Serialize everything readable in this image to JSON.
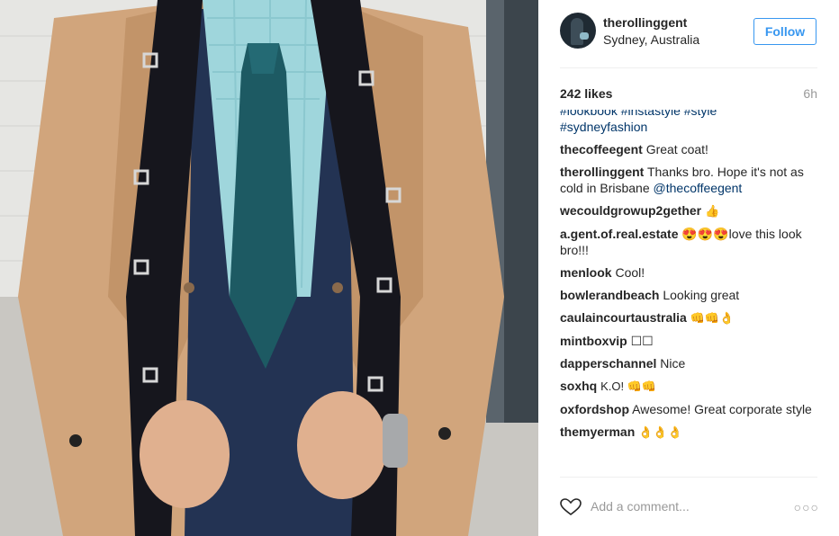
{
  "post": {
    "username": "therollinggent",
    "location": "Sydney, Australia",
    "follow_label": "Follow",
    "likes": "242 likes",
    "time_ago": "6h",
    "caption_cut": "#lookbook #instastyle #style",
    "caption_last": "#sydneyfashion"
  },
  "comments": [
    {
      "user": "thecoffeegent",
      "text": "Great coat!"
    },
    {
      "user": "therollinggent",
      "text": "Thanks bro. Hope it's not as cold in Brisbane ",
      "mention": "@thecoffeegent"
    },
    {
      "user": "wecouldgrowup2gether",
      "text": "👍"
    },
    {
      "user": "a.gent.of.real.estate",
      "text": "😍😍😍love this look bro!!!"
    },
    {
      "user": "menlook",
      "text": "Cool!"
    },
    {
      "user": "bowlerandbeach",
      "text": "Looking great"
    },
    {
      "user": "caulaincourtaustralia",
      "text": "👊👊👌"
    },
    {
      "user": "mintboxvip",
      "text": "☐☐"
    },
    {
      "user": "dapperschannel",
      "text": "Nice"
    },
    {
      "user": "soxhq",
      "text": "K.O! 👊👊"
    },
    {
      "user": "oxfordshop",
      "text": "Awesome! Great corporate style"
    },
    {
      "user": "themyerman",
      "text": "👌👌👌"
    }
  ],
  "footer": {
    "add_comment_placeholder": "Add a comment...",
    "more_glyph": "○○○"
  },
  "icons": {
    "like": "heart-outline-icon",
    "more": "more-options-icon"
  },
  "colors": {
    "link": "#003569",
    "follow": "#3897f0",
    "muted": "#999999"
  }
}
